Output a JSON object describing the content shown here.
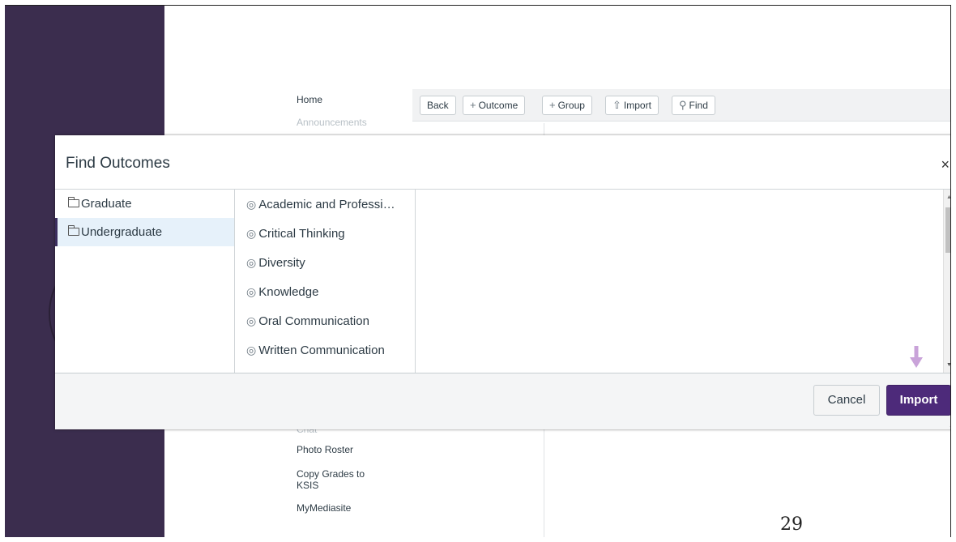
{
  "course_nav": {
    "home": "Home",
    "announcements": "Announcements",
    "chat": "Chat",
    "photo_roster": "Photo Roster",
    "copy_grades_1": "Copy Grades to",
    "copy_grades_2": "KSIS",
    "mymediasite": "MyMediasite"
  },
  "toolbar": {
    "back": "Back",
    "outcome": "Outcome",
    "group": "Group",
    "import": "Import",
    "find": "Find"
  },
  "modal": {
    "title": "Find Outcomes",
    "close": "×",
    "groups": [
      {
        "label": "Graduate",
        "selected": false
      },
      {
        "label": "Undergraduate",
        "selected": true
      }
    ],
    "outcomes": [
      "Academic and Professi…",
      "Critical Thinking",
      "Diversity",
      "Knowledge",
      "Oral Communication",
      "Written Communication"
    ],
    "cancel_label": "Cancel",
    "import_label": "Import"
  },
  "slide_number": "29",
  "colors": {
    "sidebar": "#3b2d4e",
    "import_button": "#4d2a7a",
    "arrow": "#c9a3d9",
    "selected_row": "#e6f1fa"
  }
}
